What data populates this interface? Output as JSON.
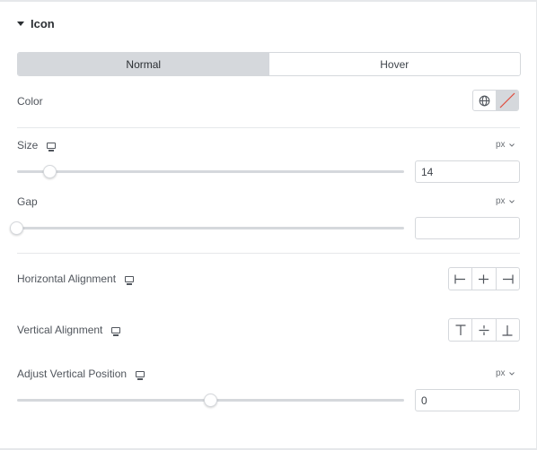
{
  "section": {
    "title": "Icon"
  },
  "tabs": [
    {
      "label": "Normal",
      "active": true
    },
    {
      "label": "Hover",
      "active": false
    }
  ],
  "color": {
    "label": "Color",
    "globe_icon": "globe-icon",
    "swatch_icon": "no-color-swatch"
  },
  "size": {
    "label": "Size",
    "unit": "px",
    "value": "14",
    "slider_value": 14
  },
  "gap": {
    "label": "Gap",
    "unit": "px",
    "value": "",
    "slider_value": 0
  },
  "horizontal_alignment": {
    "label": "Horizontal Alignment",
    "options": [
      "align-start-horizontal-icon",
      "align-center-horizontal-icon",
      "align-end-horizontal-icon"
    ]
  },
  "vertical_alignment": {
    "label": "Vertical Alignment",
    "options": [
      "align-top-icon",
      "align-middle-icon",
      "align-bottom-icon"
    ]
  },
  "adjust_vertical_position": {
    "label": "Adjust Vertical Position",
    "unit": "px",
    "value": "0",
    "slider_value": 0
  },
  "colors": {
    "border": "#d5d8dc",
    "active_tab": "#d5d8dc",
    "text": "#50555c",
    "strike": "#e04a3a"
  }
}
